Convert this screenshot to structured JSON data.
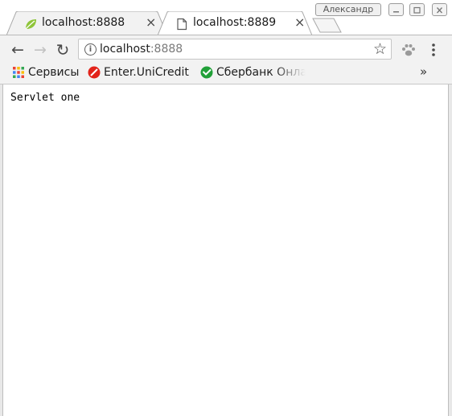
{
  "tabs": [
    {
      "title": "localhost:8888",
      "favicon": "leaf-icon",
      "active": true,
      "close": "×"
    },
    {
      "title": "localhost:8889",
      "favicon": "page-icon",
      "active": false,
      "close": "×"
    }
  ],
  "window": {
    "profile_name": "Александр"
  },
  "toolbar": {
    "back": "←",
    "forward": "→",
    "reload": "↻",
    "info_glyph": "i",
    "url_host": "localhost",
    "url_port": ":8888",
    "bookmark_star": "☆",
    "extension_icon": "paw-icon",
    "menu_icon": "kebab-menu-icon"
  },
  "bookmarks": {
    "items": [
      {
        "label": "Сервисы",
        "icon": "apps-grid-icon"
      },
      {
        "label": "Enter.UniCredit",
        "icon": "unicredit-logo-icon"
      },
      {
        "label": "Сбербанк Онлайн",
        "icon": "sberbank-logo-icon"
      }
    ],
    "overflow": "»"
  },
  "page": {
    "text": "Servlet one"
  },
  "colors": {
    "leaf_green": "#8fc53a",
    "unicredit_red": "#e2231a",
    "sber_green": "#21a038",
    "apps_colors": [
      "#ea4335",
      "#fbbc05",
      "#34a853",
      "#4285f4"
    ]
  }
}
